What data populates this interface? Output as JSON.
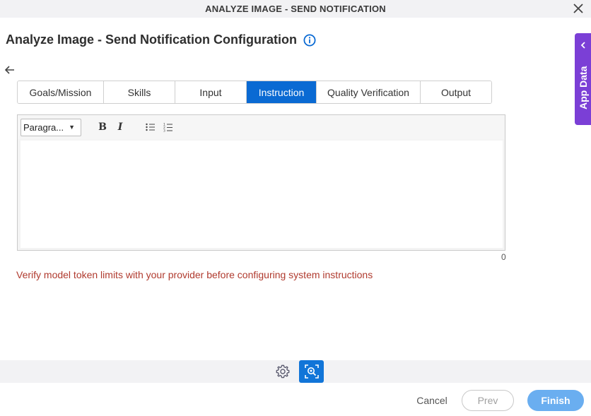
{
  "window": {
    "title": "ANALYZE IMAGE - SEND NOTIFICATION",
    "close_icon": "close-icon"
  },
  "page": {
    "heading": "Analyze Image - Send Notification Configuration",
    "info_icon": "info-icon",
    "back_icon": "arrow-left-icon"
  },
  "tabs": [
    {
      "label": "Goals/Mission",
      "active": false
    },
    {
      "label": "Skills",
      "active": false
    },
    {
      "label": "Input",
      "active": false
    },
    {
      "label": "Instruction",
      "active": true
    },
    {
      "label": "Quality Verification",
      "active": false
    },
    {
      "label": "Output",
      "active": false
    }
  ],
  "editor": {
    "format_value": "Paragra...",
    "bold_label": "B",
    "italic_label": "I",
    "bullet_list_icon": "bullet-list-icon",
    "numbered_list_icon": "numbered-list-icon",
    "content": "",
    "char_count": "0"
  },
  "warning_text": "Verify model token limits with your provider before configuring system instructions",
  "app_data": {
    "label": "App Data",
    "icon": "chevron-left-icon"
  },
  "bottom_toolbar": {
    "gear_icon": "gear-icon",
    "ai_icon": "ai-image-search-icon"
  },
  "footer": {
    "cancel_label": "Cancel",
    "prev_label": "Prev",
    "finish_label": "Finish"
  },
  "colors": {
    "accent": "#0a6ad3",
    "app_data_panel": "#7b3fd6",
    "warning": "#b03a2e",
    "finish_button": "#6aaef0"
  }
}
